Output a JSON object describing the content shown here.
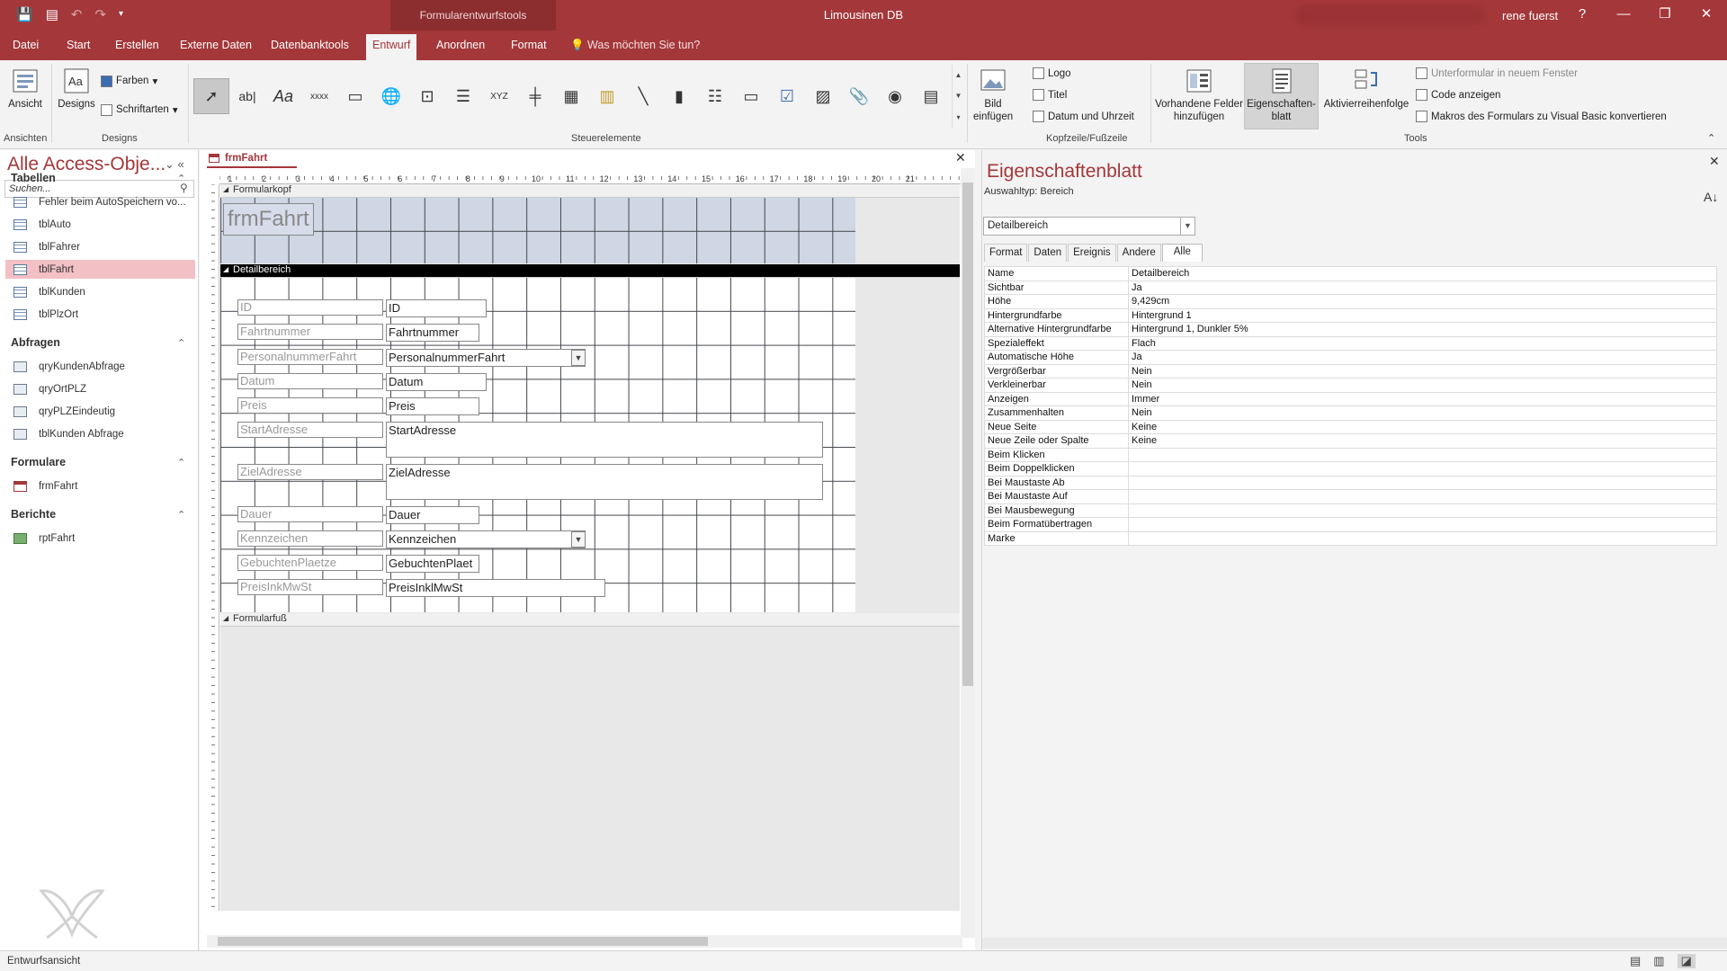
{
  "titlebar": {
    "context_tools": "Formularentwurfstools",
    "app_title": "Limousinen DB",
    "username": "rene fuerst",
    "help": "?",
    "minimize": "—",
    "restore": "❐",
    "close": "✕"
  },
  "menu": {
    "tabs": [
      "Datei",
      "Start",
      "Erstellen",
      "Externe Daten",
      "Datenbanktools",
      "Entwurf",
      "Anordnen",
      "Format"
    ],
    "active": "Entwurf",
    "tellme": "Was möchten Sie tun?"
  },
  "ribbon": {
    "ansicht_label": "Ansicht",
    "designs_label": "Designs",
    "farben_label": "Farben",
    "schriftarten_label": "Schriftarten",
    "group_ansichten": "Ansichten",
    "group_designs": "Designs",
    "group_steuerelemente": "Steuerelemente",
    "bild_einfuegen": "Bild einfügen",
    "logo": "Logo",
    "titel": "Titel",
    "datum_uhrzeit": "Datum und Uhrzeit",
    "group_kopf": "Kopfzeile/Fußzeile",
    "vorhandene_felder": "Vorhandene Felder hinzufügen",
    "eigenschaftenblatt": "Eigenschaften-blatt",
    "aktivierreihenfolge": "Aktivierreihenfolge",
    "unterformular": "Unterformular in neuem Fenster",
    "code_anzeigen": "Code anzeigen",
    "makros_konvertieren": "Makros des Formulars zu Visual Basic konvertieren",
    "group_tools": "Tools",
    "controls": [
      "pointer",
      "ab|",
      "Aa",
      "xxxx",
      "tab",
      "link",
      "web",
      "nav",
      "XYZ",
      "break",
      "subform",
      "chart",
      "line",
      "toggle",
      "list",
      "rect",
      "check",
      "image",
      "attach",
      "option",
      "combo"
    ]
  },
  "nav": {
    "title": "Alle Access-Obje...",
    "search_placeholder": "Suchen...",
    "groups": [
      {
        "label": "Tabellen",
        "items": [
          "Fehler beim AutoSpeichern vo...",
          "tblAuto",
          "tblFahrer",
          "tblFahrt",
          "tblKunden",
          "tblPlzOrt"
        ]
      },
      {
        "label": "Abfragen",
        "items": [
          "qryKundenAbfrage",
          "qryOrtPLZ",
          "qryPLZEindeutig",
          "tblKunden Abfrage"
        ]
      },
      {
        "label": "Formulare",
        "items": [
          "frmFahrt"
        ]
      },
      {
        "label": "Berichte",
        "items": [
          "rptFahrt"
        ]
      }
    ],
    "selected": "tblFahrt"
  },
  "document": {
    "tab": "frmFahrt",
    "section_header": "Formularkopf",
    "section_detail": "Detailbereich",
    "section_footer": "Formularfuß",
    "form_title": "frmFahrt",
    "ruler_numbers": [
      "1",
      "2",
      "3",
      "4",
      "5",
      "6",
      "7",
      "8",
      "9",
      "10",
      "11",
      "12",
      "13",
      "14",
      "15",
      "16",
      "17",
      "18",
      "19",
      "20",
      "21"
    ],
    "fields": [
      {
        "label": "ID",
        "control": "ID"
      },
      {
        "label": "Fahrtnummer",
        "control": "Fahrtnummer"
      },
      {
        "label": "PersonalnummerFahrt",
        "control": "PersonalnummerFahrt"
      },
      {
        "label": "Datum",
        "control": "Datum"
      },
      {
        "label": "Preis",
        "control": "Preis"
      },
      {
        "label": "StartAdresse",
        "control": "StartAdresse"
      },
      {
        "label": "ZielAdresse",
        "control": "ZielAdresse"
      },
      {
        "label": "Dauer",
        "control": "Dauer"
      },
      {
        "label": "Kennzeichen",
        "control": "Kennzeichen"
      },
      {
        "label": "GebuchtenPlaetze",
        "control": "GebuchtenPlaet"
      },
      {
        "label": "PreisInkMwSt",
        "control": "PreisInklMwSt"
      }
    ]
  },
  "propsheet": {
    "title": "Eigenschaftenblatt",
    "selection_type": "Auswahltyp:  Bereich",
    "selected_object": "Detailbereich",
    "tabs": [
      "Format",
      "Daten",
      "Ereignis",
      "Andere",
      "Alle"
    ],
    "active_tab": "Alle",
    "rows": [
      [
        "Name",
        "Detailbereich"
      ],
      [
        "Sichtbar",
        "Ja"
      ],
      [
        "Höhe",
        "9,429cm"
      ],
      [
        "Hintergrundfarbe",
        "Hintergrund 1"
      ],
      [
        "Alternative Hintergrundfarbe",
        "Hintergrund 1, Dunkler 5%"
      ],
      [
        "Spezialeffekt",
        "Flach"
      ],
      [
        "Automatische Höhe",
        "Ja"
      ],
      [
        "Vergrößerbar",
        "Nein"
      ],
      [
        "Verkleinerbar",
        "Nein"
      ],
      [
        "Anzeigen",
        "Immer"
      ],
      [
        "Zusammenhalten",
        "Nein"
      ],
      [
        "Neue Seite",
        "Keine"
      ],
      [
        "Neue Zeile oder Spalte",
        "Keine"
      ],
      [
        "Beim Klicken",
        ""
      ],
      [
        "Beim Doppelklicken",
        ""
      ],
      [
        "Bei Maustaste Ab",
        ""
      ],
      [
        "Bei Maustaste Auf",
        ""
      ],
      [
        "Bei Mausbewegung",
        ""
      ],
      [
        "Beim Formatübertragen",
        ""
      ],
      [
        "Marke",
        ""
      ]
    ]
  },
  "status": {
    "text": "Entwurfsansicht"
  },
  "colors": {
    "accent": "#a4373a",
    "selected_nav": "#f2c0c5",
    "header_section": "#cfd6e4"
  }
}
